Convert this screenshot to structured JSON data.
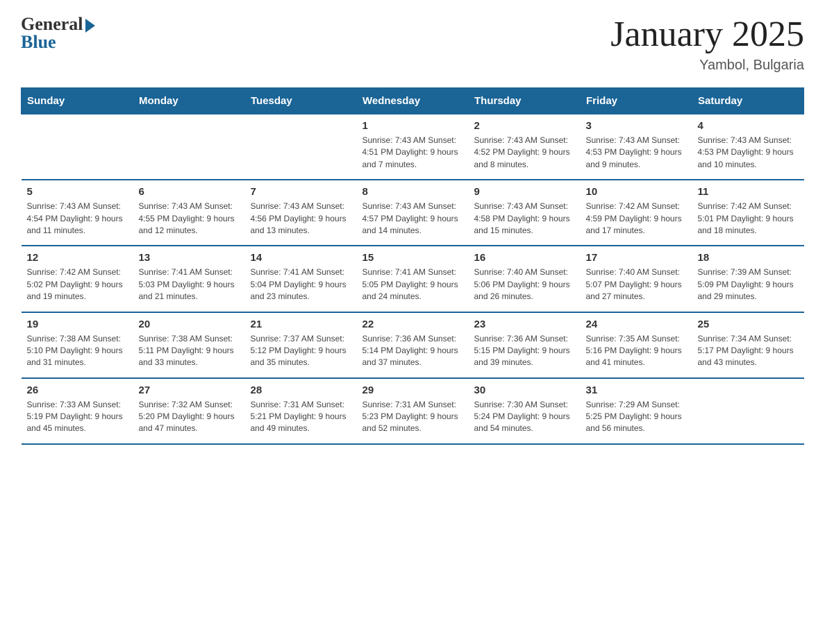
{
  "header": {
    "logo_general": "General",
    "logo_blue": "Blue",
    "title": "January 2025",
    "subtitle": "Yambol, Bulgaria"
  },
  "weekdays": [
    "Sunday",
    "Monday",
    "Tuesday",
    "Wednesday",
    "Thursday",
    "Friday",
    "Saturday"
  ],
  "weeks": [
    [
      {
        "day": "",
        "info": ""
      },
      {
        "day": "",
        "info": ""
      },
      {
        "day": "",
        "info": ""
      },
      {
        "day": "1",
        "info": "Sunrise: 7:43 AM\nSunset: 4:51 PM\nDaylight: 9 hours and 7 minutes."
      },
      {
        "day": "2",
        "info": "Sunrise: 7:43 AM\nSunset: 4:52 PM\nDaylight: 9 hours and 8 minutes."
      },
      {
        "day": "3",
        "info": "Sunrise: 7:43 AM\nSunset: 4:53 PM\nDaylight: 9 hours and 9 minutes."
      },
      {
        "day": "4",
        "info": "Sunrise: 7:43 AM\nSunset: 4:53 PM\nDaylight: 9 hours and 10 minutes."
      }
    ],
    [
      {
        "day": "5",
        "info": "Sunrise: 7:43 AM\nSunset: 4:54 PM\nDaylight: 9 hours and 11 minutes."
      },
      {
        "day": "6",
        "info": "Sunrise: 7:43 AM\nSunset: 4:55 PM\nDaylight: 9 hours and 12 minutes."
      },
      {
        "day": "7",
        "info": "Sunrise: 7:43 AM\nSunset: 4:56 PM\nDaylight: 9 hours and 13 minutes."
      },
      {
        "day": "8",
        "info": "Sunrise: 7:43 AM\nSunset: 4:57 PM\nDaylight: 9 hours and 14 minutes."
      },
      {
        "day": "9",
        "info": "Sunrise: 7:43 AM\nSunset: 4:58 PM\nDaylight: 9 hours and 15 minutes."
      },
      {
        "day": "10",
        "info": "Sunrise: 7:42 AM\nSunset: 4:59 PM\nDaylight: 9 hours and 17 minutes."
      },
      {
        "day": "11",
        "info": "Sunrise: 7:42 AM\nSunset: 5:01 PM\nDaylight: 9 hours and 18 minutes."
      }
    ],
    [
      {
        "day": "12",
        "info": "Sunrise: 7:42 AM\nSunset: 5:02 PM\nDaylight: 9 hours and 19 minutes."
      },
      {
        "day": "13",
        "info": "Sunrise: 7:41 AM\nSunset: 5:03 PM\nDaylight: 9 hours and 21 minutes."
      },
      {
        "day": "14",
        "info": "Sunrise: 7:41 AM\nSunset: 5:04 PM\nDaylight: 9 hours and 23 minutes."
      },
      {
        "day": "15",
        "info": "Sunrise: 7:41 AM\nSunset: 5:05 PM\nDaylight: 9 hours and 24 minutes."
      },
      {
        "day": "16",
        "info": "Sunrise: 7:40 AM\nSunset: 5:06 PM\nDaylight: 9 hours and 26 minutes."
      },
      {
        "day": "17",
        "info": "Sunrise: 7:40 AM\nSunset: 5:07 PM\nDaylight: 9 hours and 27 minutes."
      },
      {
        "day": "18",
        "info": "Sunrise: 7:39 AM\nSunset: 5:09 PM\nDaylight: 9 hours and 29 minutes."
      }
    ],
    [
      {
        "day": "19",
        "info": "Sunrise: 7:38 AM\nSunset: 5:10 PM\nDaylight: 9 hours and 31 minutes."
      },
      {
        "day": "20",
        "info": "Sunrise: 7:38 AM\nSunset: 5:11 PM\nDaylight: 9 hours and 33 minutes."
      },
      {
        "day": "21",
        "info": "Sunrise: 7:37 AM\nSunset: 5:12 PM\nDaylight: 9 hours and 35 minutes."
      },
      {
        "day": "22",
        "info": "Sunrise: 7:36 AM\nSunset: 5:14 PM\nDaylight: 9 hours and 37 minutes."
      },
      {
        "day": "23",
        "info": "Sunrise: 7:36 AM\nSunset: 5:15 PM\nDaylight: 9 hours and 39 minutes."
      },
      {
        "day": "24",
        "info": "Sunrise: 7:35 AM\nSunset: 5:16 PM\nDaylight: 9 hours and 41 minutes."
      },
      {
        "day": "25",
        "info": "Sunrise: 7:34 AM\nSunset: 5:17 PM\nDaylight: 9 hours and 43 minutes."
      }
    ],
    [
      {
        "day": "26",
        "info": "Sunrise: 7:33 AM\nSunset: 5:19 PM\nDaylight: 9 hours and 45 minutes."
      },
      {
        "day": "27",
        "info": "Sunrise: 7:32 AM\nSunset: 5:20 PM\nDaylight: 9 hours and 47 minutes."
      },
      {
        "day": "28",
        "info": "Sunrise: 7:31 AM\nSunset: 5:21 PM\nDaylight: 9 hours and 49 minutes."
      },
      {
        "day": "29",
        "info": "Sunrise: 7:31 AM\nSunset: 5:23 PM\nDaylight: 9 hours and 52 minutes."
      },
      {
        "day": "30",
        "info": "Sunrise: 7:30 AM\nSunset: 5:24 PM\nDaylight: 9 hours and 54 minutes."
      },
      {
        "day": "31",
        "info": "Sunrise: 7:29 AM\nSunset: 5:25 PM\nDaylight: 9 hours and 56 minutes."
      },
      {
        "day": "",
        "info": ""
      }
    ]
  ]
}
